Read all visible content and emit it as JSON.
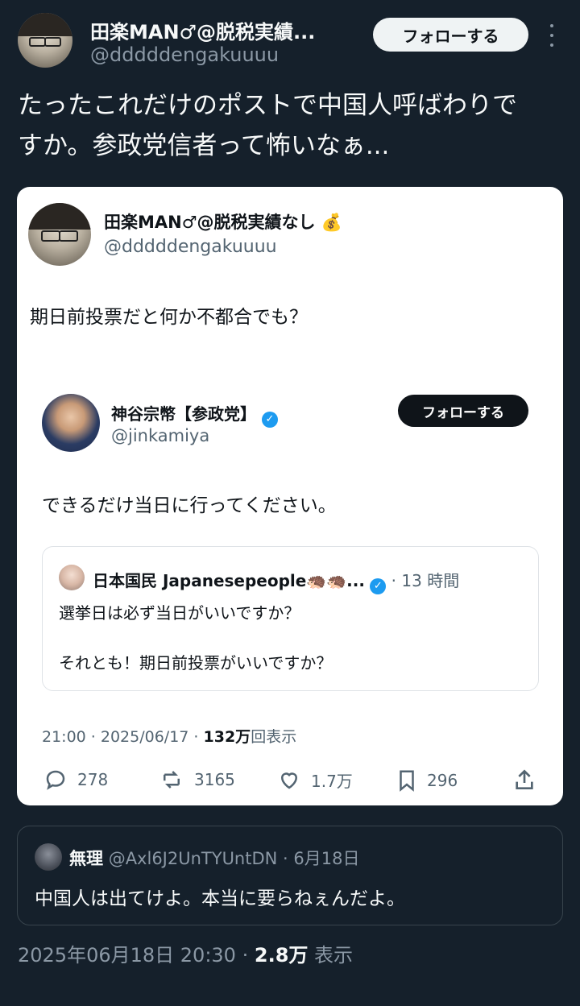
{
  "post": {
    "author_name": "田楽MAN♂@脱税実績...",
    "handle": "@dddddengakuuuu",
    "follow_label": "フォローする",
    "text_line1": "たったこれだけのポストで中国人呼ばわりで",
    "text_line2": "すか。参政党信者って怖いなぁ...",
    "timestamp": "2025年06月18日 20:30",
    "views_count": "2.8万",
    "views_label": "表示"
  },
  "quoted": {
    "author_name": "田楽MAN♂@脱税実績なし",
    "author_emoji": "💰",
    "handle": "@dddddengakuuuu",
    "text": "期日前投票だと何か不都合でも？",
    "meta_time": "21:00 · 2025/06/17 ·",
    "meta_views_count": "132万",
    "meta_views_label": "回表示",
    "stats": {
      "replies": "278",
      "retweets": "3165",
      "likes": "1.7万",
      "bookmarks": "296"
    }
  },
  "embedded": {
    "author_name": "神谷宗幣【参政党】",
    "handle": "@jinkamiya",
    "follow_label": "フォローする",
    "text": "できるだけ当日に行ってください。"
  },
  "nested": {
    "author_name": "日本国民 Japanesepeople🦔",
    "author_tail": "🦔...",
    "age": "· 13 時間",
    "line1": "選挙日は必ず当日がいいですか？",
    "line2": "それとも！期日前投票がいいですか？"
  },
  "reply_preview": {
    "author_name": "無理",
    "handle": "@Axl6J2UnTYUntDN",
    "date": "· 6月18日",
    "text": "中国人は出てけよ。本当に要らねぇんだよ。"
  }
}
